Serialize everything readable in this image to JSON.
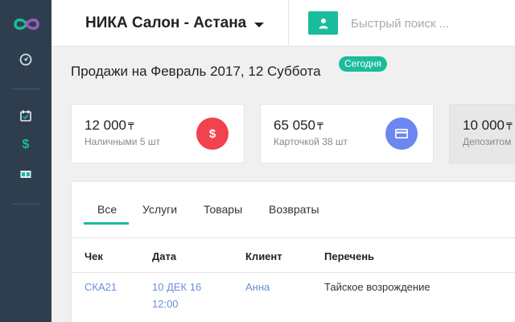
{
  "header": {
    "salon_name": "НИКА Салон - Астана",
    "search_placeholder": "Быстрый поиск ..."
  },
  "page": {
    "title": "Продажи на Февраль 2017, 12 Суббота",
    "today_badge": "Сегодня"
  },
  "cards": [
    {
      "amount": "12 000",
      "currency": "₸",
      "subtitle": "Наличными 5 шт",
      "icon": "dollar-icon",
      "color": "#f0424f"
    },
    {
      "amount": "65 050",
      "currency": "₸",
      "subtitle": "Карточкой 38 шт",
      "icon": "credit-card-icon",
      "color": "#6b87f0"
    },
    {
      "amount": "10 000",
      "currency": "₸",
      "subtitle": "Депозитом"
    }
  ],
  "tabs": [
    "Все",
    "Услуги",
    "Товары",
    "Возвраты"
  ],
  "table": {
    "columns": [
      "Чек",
      "Дата",
      "Клиент",
      "Перечень"
    ],
    "rows": [
      {
        "check": "СКА21",
        "date_line1": "10 ДЕК 16",
        "date_line2": "12:00",
        "client": "Анна",
        "items": "Тайское возрождение"
      }
    ]
  },
  "colors": {
    "sidebar": "#2f3e4e",
    "accent": "#1abc9c",
    "link": "#6d8fd8"
  }
}
